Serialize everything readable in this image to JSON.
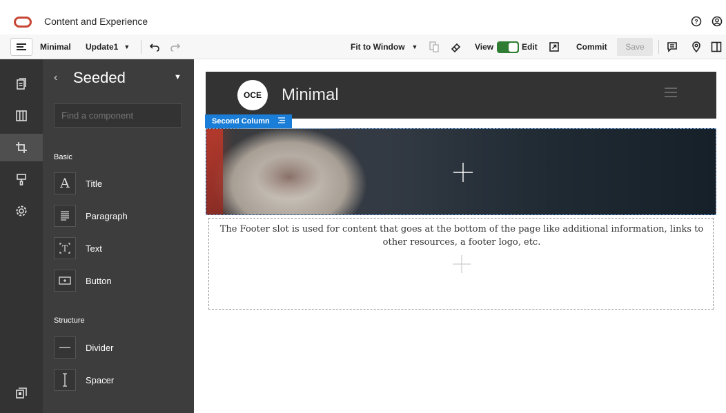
{
  "app": {
    "title": "Content and Experience"
  },
  "toolbar": {
    "site_name": "Minimal",
    "update": "Update1",
    "zoom": "Fit to Window",
    "view_label": "View",
    "edit_label": "Edit",
    "mode_edit_on": true,
    "commit_label": "Commit",
    "save_label": "Save"
  },
  "panel": {
    "title": "Seeded",
    "search_placeholder": "Find a component",
    "sections": [
      {
        "name": "Basic",
        "items": [
          "Title",
          "Paragraph",
          "Text",
          "Button"
        ]
      },
      {
        "name": "Structure",
        "items": [
          "Divider",
          "Spacer"
        ]
      }
    ]
  },
  "canvas": {
    "logo_text": "OCE",
    "site_title": "Minimal",
    "slot_tag": "Second Column",
    "footer_text": "The Footer slot is used for content that goes at the bottom of the page like additional information, links to other resources, a footer logo, etc."
  },
  "colors": {
    "accent": "#1a7ed8",
    "brand": "#c74634",
    "toggle": "#2e7d32"
  }
}
